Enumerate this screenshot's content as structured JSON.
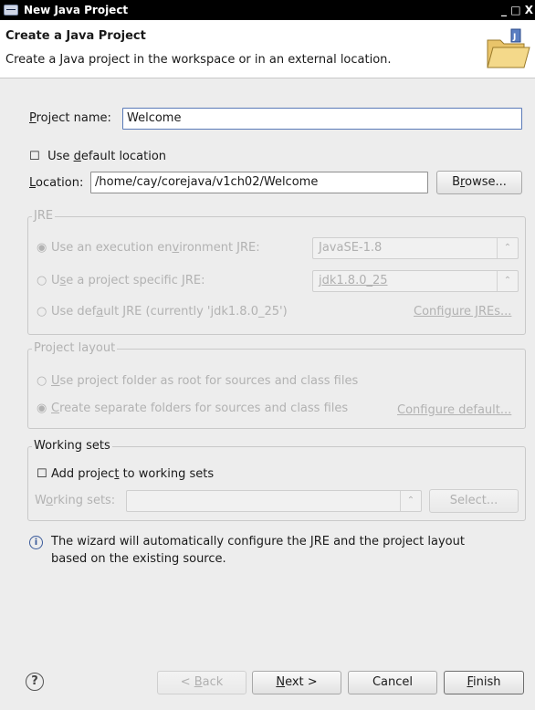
{
  "window": {
    "title": "New Java Project",
    "controls": "_ □ X"
  },
  "header": {
    "title": "Create a Java Project",
    "description": "Create a Java project in the workspace or in an external location."
  },
  "project": {
    "name_label_first": "P",
    "name_label_rest": "roject name:",
    "name_value": "Welcome"
  },
  "default_location": {
    "pre": "Use ",
    "mnemonic": "d",
    "post": "efault location",
    "checked": false
  },
  "location": {
    "label_first": "L",
    "label_rest": "ocation:",
    "value": "/home/cay/corejava/v1ch02/Welcome",
    "browse_pre": "B",
    "browse_mnemonic": "r",
    "browse_post": "owse..."
  },
  "jre": {
    "group_title": "JRE",
    "option1": {
      "pre": "Use an execution en",
      "mnemonic": "v",
      "post": "ironment JRE:",
      "selected": true,
      "combo": "JavaSE-1.8"
    },
    "option2": {
      "pre": "U",
      "mnemonic": "s",
      "post": "e a project specific JRE:",
      "selected": false,
      "combo": "jdk1.8.0_25"
    },
    "option3": {
      "pre": "Use def",
      "mnemonic": "a",
      "post": "ult JRE (currently 'jdk1.8.0_25')",
      "selected": false
    },
    "configure_link": "Configure JREs..."
  },
  "layout": {
    "group_title": "Project layout",
    "option1": {
      "pre": "",
      "mnemonic": "U",
      "post": "se project folder as root for sources and class files",
      "selected": false
    },
    "option2": {
      "pre": "",
      "mnemonic": "C",
      "post": "reate separate folders for sources and class files",
      "selected": true
    },
    "configure_link": "Configure default..."
  },
  "working_sets": {
    "group_title": "Working sets",
    "add_pre": "Add projec",
    "add_mnemonic": "t",
    "add_post": " to working sets",
    "sets_label_pre": "W",
    "sets_label_mnemonic": "o",
    "sets_label_post": "rking sets:",
    "select_label": "Select..."
  },
  "info": {
    "icon": "info-icon",
    "line1": "The wizard will automatically configure the JRE and the project layout",
    "line2": "based on the existing source."
  },
  "footer": {
    "help_icon": "help-icon",
    "back": "< Back",
    "back_mnemonic_pre": "< ",
    "back_mnemonic": "B",
    "back_post": "ack",
    "next_pre": "",
    "next_mnemonic": "N",
    "next_post": "ext >",
    "cancel": "Cancel",
    "finish_pre": "",
    "finish_mnemonic": "F",
    "finish_post": "inish"
  },
  "glyphs": {
    "checkbox_unchecked": "☐",
    "radio_on": "◉",
    "radio_off": "○",
    "combo_arrow": "⌃⌄",
    "help": "?",
    "info": "i"
  }
}
